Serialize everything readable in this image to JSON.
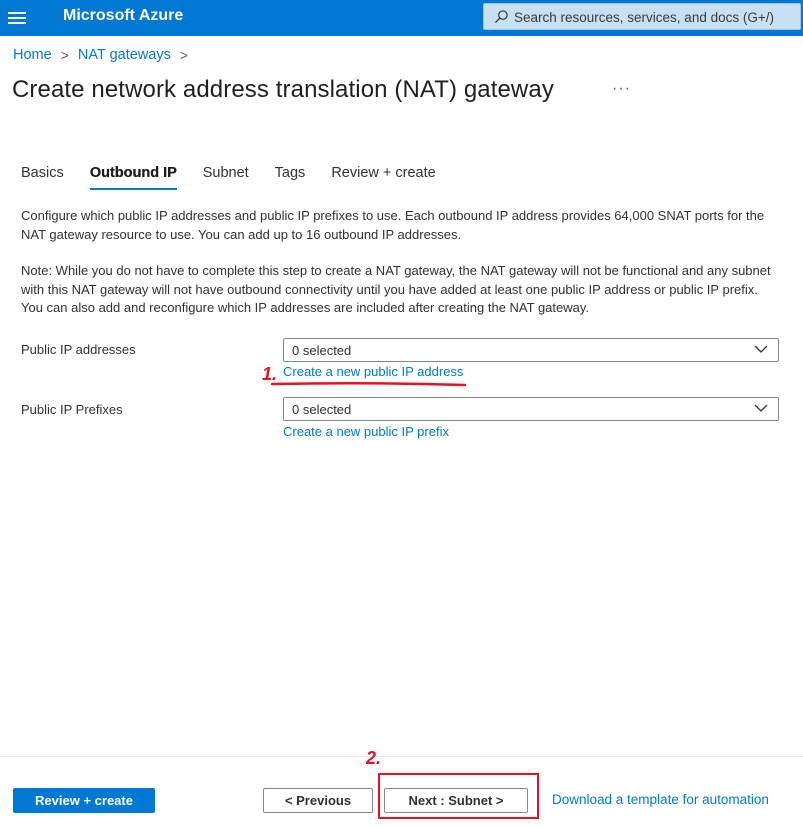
{
  "topbar": {
    "brand": "Microsoft Azure",
    "search_placeholder": "Search resources, services, and docs (G+/)"
  },
  "breadcrumb": {
    "items": [
      "Home",
      "NAT gateways"
    ],
    "separator": ">"
  },
  "page": {
    "title": "Create network address translation (NAT) gateway",
    "more": "···"
  },
  "tabs": [
    {
      "label": "Basics",
      "active": false
    },
    {
      "label": "Outbound IP",
      "active": true
    },
    {
      "label": "Subnet",
      "active": false
    },
    {
      "label": "Tags",
      "active": false
    },
    {
      "label": "Review + create",
      "active": false
    }
  ],
  "content": {
    "description": "Configure which public IP addresses and public IP prefixes to use. Each outbound IP address provides 64,000 SNAT ports for the NAT gateway resource to use. You can add up to 16 outbound IP addresses.",
    "note": "Note: While you do not have to complete this step to create a NAT gateway, the NAT gateway will not be functional and any subnet with this NAT gateway will not have outbound connectivity until you have added at least one public IP address or public IP prefix. You can also add and reconfigure which IP addresses are included after creating the NAT gateway."
  },
  "fields": {
    "public_ip": {
      "label": "Public IP addresses",
      "value": "0 selected",
      "link": "Create a new public IP address"
    },
    "public_prefix": {
      "label": "Public IP Prefixes",
      "value": "0 selected",
      "link": "Create a new public IP prefix"
    }
  },
  "annotations": {
    "step1": "1.",
    "step2": "2.",
    "color": "#e81123"
  },
  "footer": {
    "review_create": "Review + create",
    "previous": "< Previous",
    "next": "Next : Subnet >",
    "download_link": "Download a template for automation"
  },
  "colors": {
    "accent": "#0078d4",
    "search_bg": "#c7e0f4"
  }
}
